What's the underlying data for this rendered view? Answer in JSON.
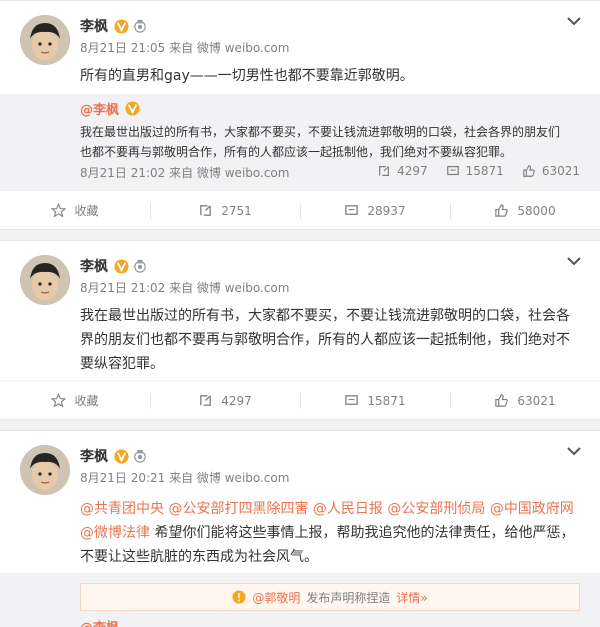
{
  "user": {
    "name": "李枫",
    "at_name": "@李枫"
  },
  "colors": {
    "accent": "#eb7350",
    "verified": "#f5a623",
    "meta": "#808080"
  },
  "posts": [
    {
      "meta": "8月21日 21:05 来自 微博 weibo.com",
      "text": "所有的直男和gay——一切男性也都不要靠近郭敬明。",
      "repost": {
        "author": "@李枫",
        "text": "我在最世出版过的所有书，大家都不要买，不要让钱流进郭敬明的口袋，社会各界的朋友们也都不要再与郭敬明合作，所有的人都应该一起抵制他，我们绝对不要纵容犯罪。",
        "meta": "8月21日 21:02 来自 微博 weibo.com",
        "reposts": "4297",
        "comments": "15871",
        "likes": "63021"
      },
      "actions": {
        "favorite": "收藏",
        "reposts": "2751",
        "comments": "28937",
        "likes": "58000"
      }
    },
    {
      "meta": "8月21日 21:02 来自 微博 weibo.com",
      "text": "我在最世出版过的所有书，大家都不要买，不要让钱流进郭敬明的口袋，社会各界的朋友们也都不要再与郭敬明合作，所有的人都应该一起抵制他，我们绝对不要纵容犯罪。",
      "actions": {
        "favorite": "收藏",
        "reposts": "4297",
        "comments": "15871",
        "likes": "63021"
      }
    },
    {
      "meta": "8月21日 20:21 来自 微博 weibo.com",
      "mentions": [
        "@共青团中央",
        "@公安部打四黑除四害",
        "@人民日报",
        "@公安部刑侦局",
        "@中国政府网",
        "@微博法律"
      ],
      "text": "希望你们能将这些事情上报，帮助我追究他的法律责任，给他严惩，不要让这些肮脏的东西成为社会风气。",
      "notice": {
        "mention": "@郭敬明",
        "text": "发布声明称捏造",
        "link": "详情»"
      },
      "clipped_author": "@李枫"
    }
  ]
}
